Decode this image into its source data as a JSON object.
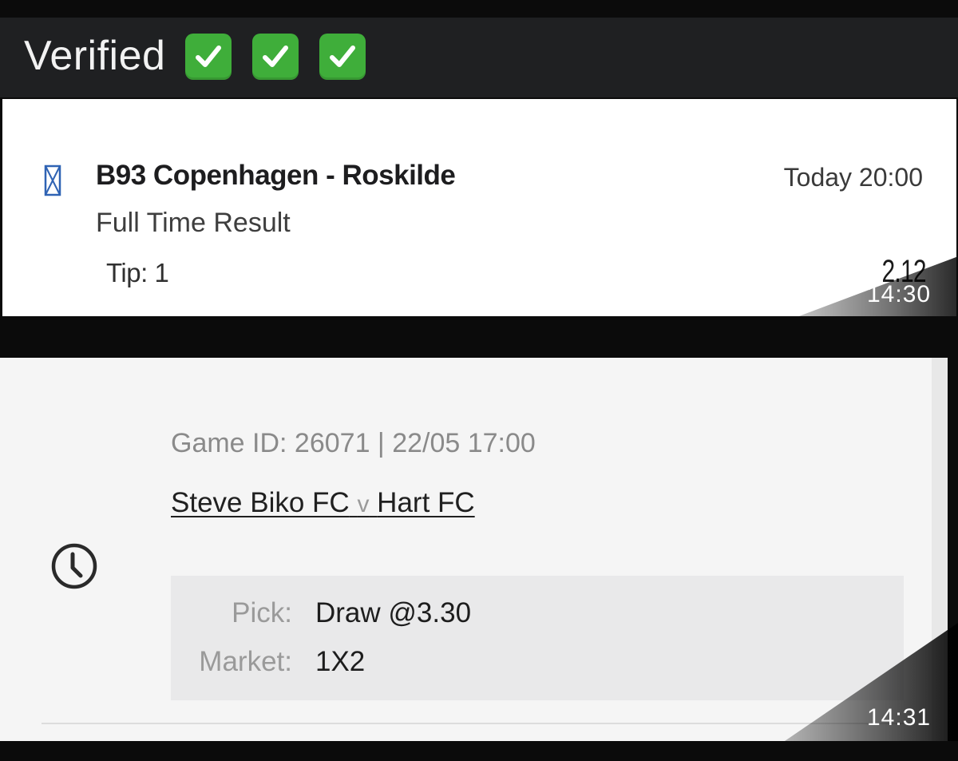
{
  "header": {
    "title": "Verified",
    "checkmarks": [
      "check-emoji",
      "check-emoji",
      "check-emoji"
    ],
    "accent_color": "#3fae3a"
  },
  "bet1": {
    "match": "B93 Copenhagen - Roskilde",
    "time": "Today 20:00",
    "market": "Full Time Result",
    "tip": "Tip: 1",
    "odds": "2.12",
    "timestamp": "14:30"
  },
  "bet2": {
    "game_id": "Game ID: 26071 | 22/05 17:00",
    "home_team": "Steve Biko FC",
    "vs": "v",
    "away_team": "Hart FC",
    "pick_label": "Pick:",
    "pick_value": "Draw @3.30",
    "market_label": "Market:",
    "market_value": "1X2",
    "timestamp": "14:31"
  }
}
